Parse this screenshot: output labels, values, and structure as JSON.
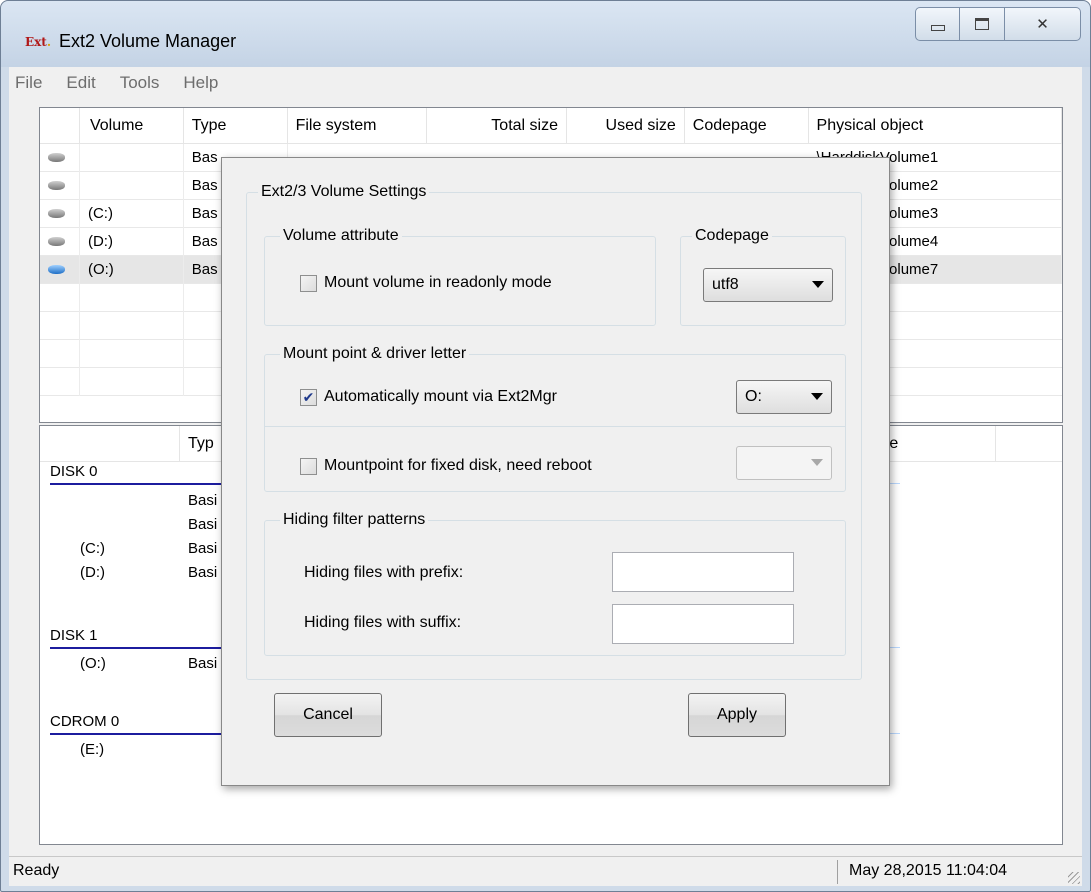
{
  "window": {
    "title": "Ext2 Volume Manager",
    "icon_text": "Ext",
    "close_glyph": "✕"
  },
  "menu": [
    "File",
    "Edit",
    "Tools",
    "Help"
  ],
  "volume_table": {
    "columns": [
      "Volume",
      "Type",
      "File system",
      "Total size",
      "Used size",
      "Codepage",
      "Physical object"
    ],
    "rows": [
      {
        "volume": "",
        "type": "Bas",
        "physical": "\\HarddiskVolume1",
        "icon": "gray-disk-icon"
      },
      {
        "volume": "",
        "type": "Bas",
        "physical": "\\HarddiskVolume2",
        "icon": "gray-disk-icon"
      },
      {
        "volume": "(C:)",
        "type": "Bas",
        "physical": "\\HarddiskVolume3",
        "icon": "gray-disk-icon"
      },
      {
        "volume": "(D:)",
        "type": "Bas",
        "physical": "\\HarddiskVolume4",
        "icon": "gray-disk-icon"
      },
      {
        "volume": "(O:)",
        "type": "Bas",
        "physical": "\\HarddiskVolume7",
        "icon": "blue-disk-icon"
      }
    ]
  },
  "disk_pane": {
    "col_type": "Typ",
    "col_right": "type",
    "groups": [
      {
        "label": "DISK 0",
        "items": [
          {
            "name": "",
            "type": "Basi"
          },
          {
            "name": "",
            "type": "Basi"
          },
          {
            "name": "(C:)",
            "type": "Basi"
          },
          {
            "name": "(D:)",
            "type": "Basi"
          }
        ]
      },
      {
        "label": "DISK 1",
        "items": [
          {
            "name": "(O:)",
            "type": "Basi"
          }
        ]
      },
      {
        "label": "CDROM 0",
        "items": [
          {
            "name": "(E:)",
            "type": ""
          }
        ]
      }
    ]
  },
  "status": {
    "left": "Ready",
    "right": "May 28,2015 11:04:04"
  },
  "dialog": {
    "group_title": "Ext2/3 Volume Settings",
    "volume_attribute": {
      "title": "Volume attribute",
      "readonly_label": "Mount volume in readonly mode",
      "readonly_checked": false
    },
    "codepage": {
      "title": "Codepage",
      "value": "utf8"
    },
    "mount": {
      "title": "Mount point & driver letter",
      "auto_label": "Automatically mount via Ext2Mgr",
      "auto_checked": true,
      "auto_letter": "O:",
      "fixed_label": "Mountpoint for fixed disk, need reboot",
      "fixed_checked": false,
      "fixed_letter": ""
    },
    "hiding": {
      "title": "Hiding filter patterns",
      "prefix_label": "Hiding files with prefix:",
      "prefix_value": "",
      "suffix_label": "Hiding files with suffix:",
      "suffix_value": ""
    },
    "cancel_label": "Cancel",
    "apply_label": "Apply",
    "check_glyph": "✔"
  }
}
